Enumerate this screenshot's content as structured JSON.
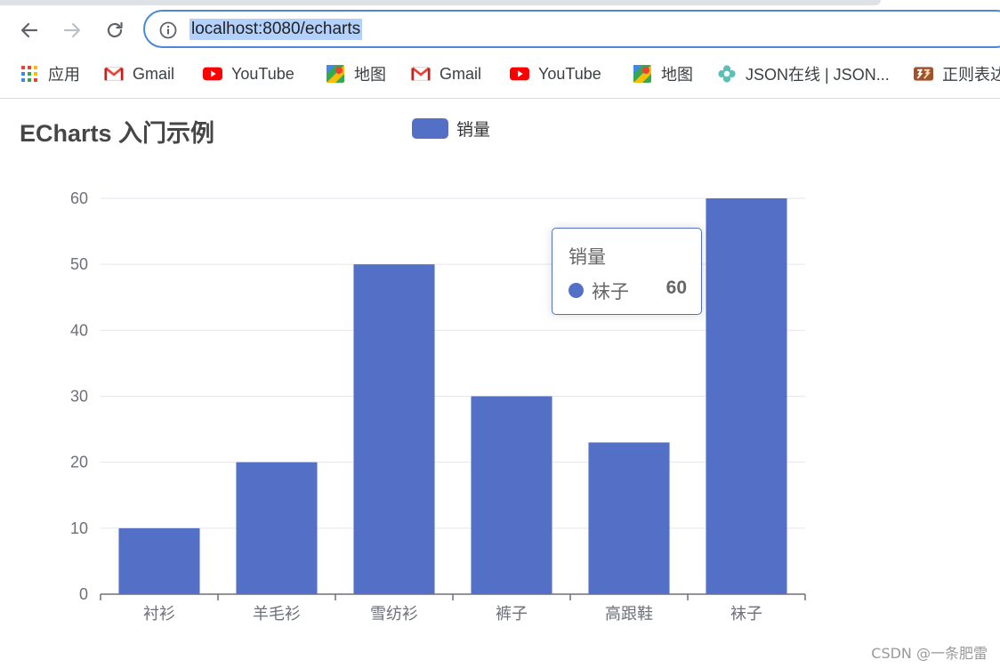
{
  "browser": {
    "url": "localhost:8080/echarts",
    "bookmarks": [
      {
        "icon": "apps-grid-icon",
        "label": "应用"
      },
      {
        "icon": "gmail-icon",
        "label": "Gmail"
      },
      {
        "icon": "youtube-icon",
        "label": "YouTube"
      },
      {
        "icon": "maps-icon",
        "label": "地图"
      },
      {
        "icon": "gmail-icon",
        "label": "Gmail"
      },
      {
        "icon": "youtube-icon",
        "label": "YouTube"
      },
      {
        "icon": "maps-icon",
        "label": "地图"
      },
      {
        "icon": "flower-icon",
        "label": "JSON在线 | JSON..."
      },
      {
        "icon": "regex-icon",
        "label": "正则表达"
      }
    ]
  },
  "chart": {
    "title": "ECharts 入门示例",
    "legend": "销量",
    "tooltip": {
      "title": "销量",
      "name": "袜子",
      "value": "60"
    }
  },
  "chart_data": {
    "type": "bar",
    "title": "ECharts 入门示例",
    "categories": [
      "衬衫",
      "羊毛衫",
      "雪纺衫",
      "裤子",
      "高跟鞋",
      "袜子"
    ],
    "series": [
      {
        "name": "销量",
        "values": [
          10,
          20,
          50,
          30,
          23,
          60
        ]
      }
    ],
    "ylim": [
      0,
      60
    ],
    "yticks": [
      0,
      10,
      20,
      30,
      40,
      50,
      60
    ],
    "grid": true,
    "legend_position": "top-center",
    "colors": {
      "bar": "#5470c6",
      "grid": "#e0e6f1",
      "axis": "#6e7079"
    }
  },
  "watermark": "CSDN @一条肥雷"
}
